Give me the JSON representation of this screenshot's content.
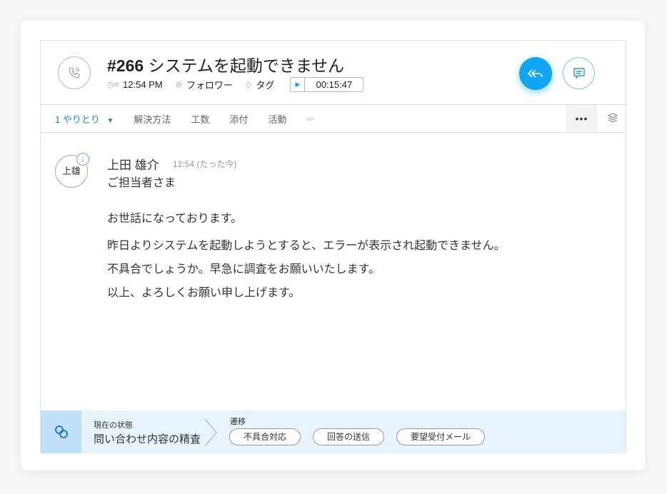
{
  "ticket": {
    "number": "#266",
    "title": "システムを起動できません",
    "time": "12:54 PM",
    "follower_label": "フォロワー",
    "tag_label": "タグ",
    "timer": "00:15:47"
  },
  "tabs": [
    {
      "label": "1 やりとり"
    },
    {
      "label": "解決方法"
    },
    {
      "label": "工数"
    },
    {
      "label": "添付"
    },
    {
      "label": "活動"
    }
  ],
  "more_label": "•••",
  "message": {
    "avatar": "上雄",
    "sender": "上田 雄介",
    "time": "12:54 (たった今)",
    "lines": [
      "ご担当者さま",
      "お世話になっております。",
      "昨日よりシステムを起動しようとすると、エラーが表示され起動できません。",
      "不具合でしょうか。早急に調査をお願いいたします。",
      "以上、よろしくお願い申し上げます。"
    ]
  },
  "status": {
    "current_label": "現在の状態",
    "current_value": "問い合わせ内容の精査",
    "transition_label": "遷移",
    "transitions": [
      "不具合対応",
      "回答の送信",
      "要望受付メール"
    ]
  },
  "colors": {
    "accent": "#0ea5f5",
    "footer_bg": "#e8f4fd"
  }
}
